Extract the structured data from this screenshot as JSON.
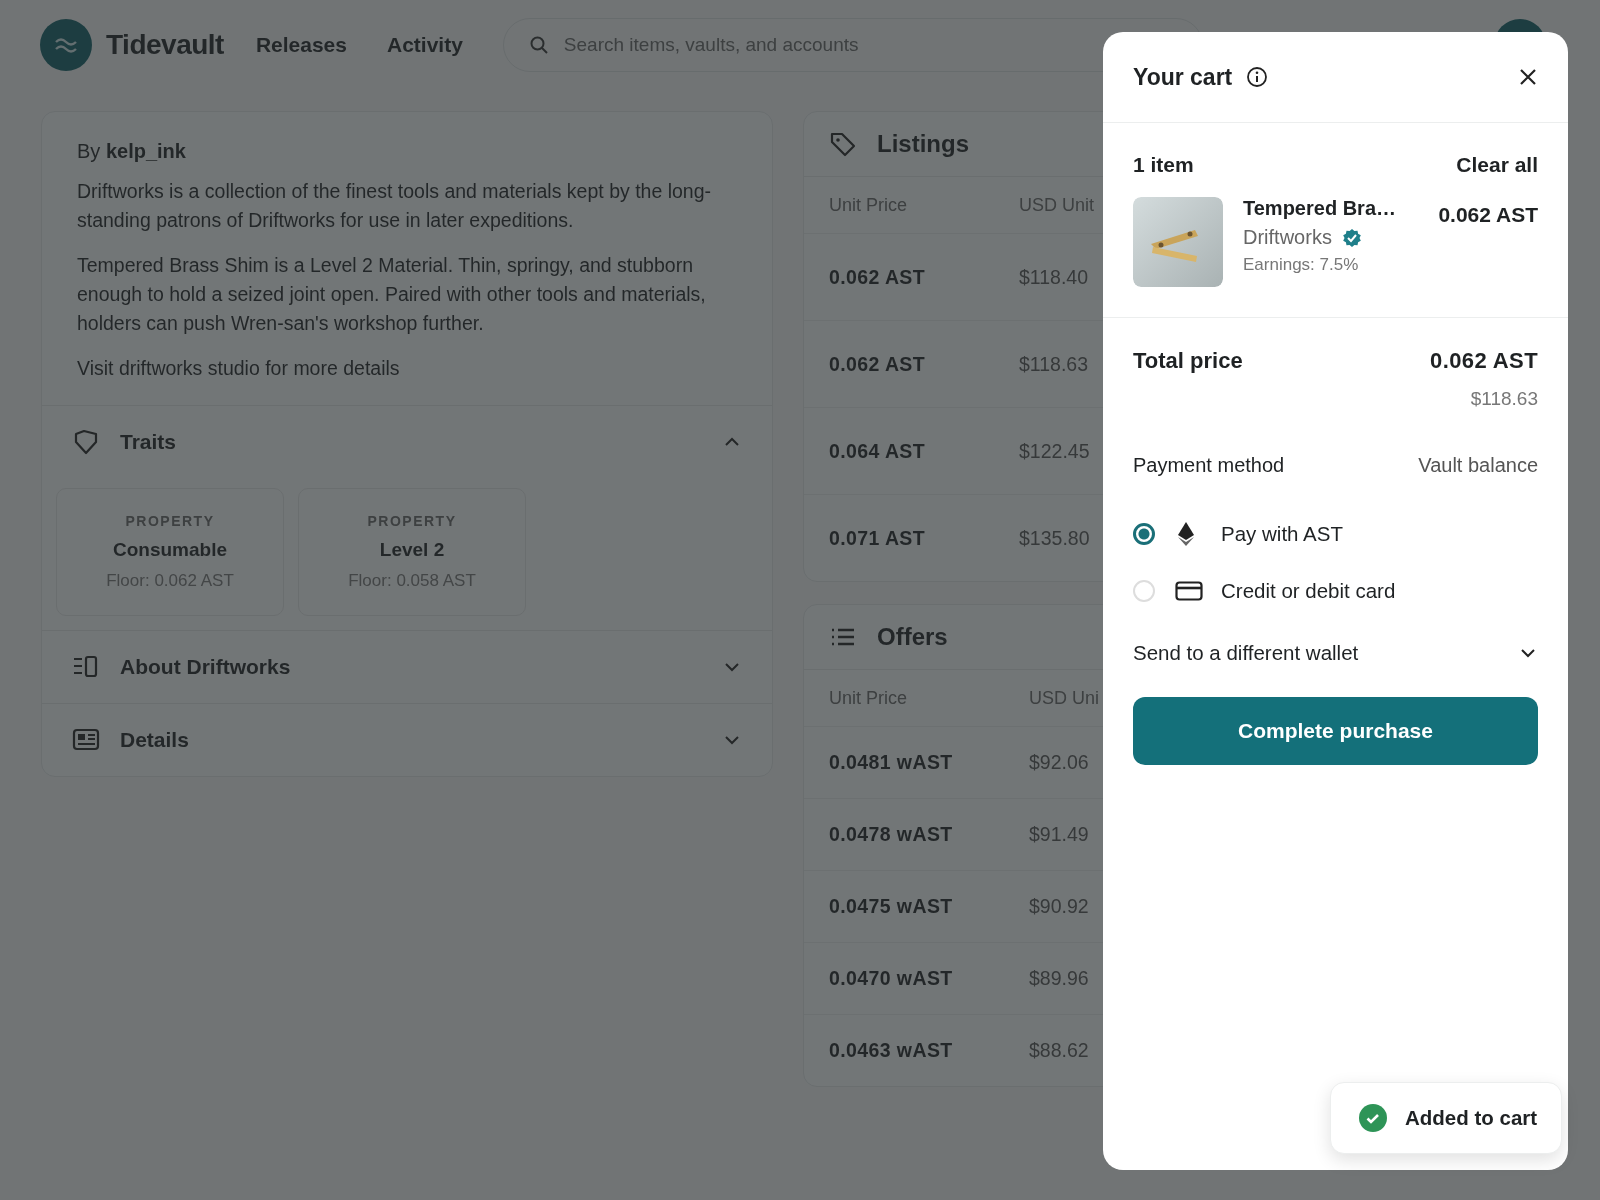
{
  "header": {
    "logo": "Tidevault",
    "nav": [
      {
        "label": "Releases"
      },
      {
        "label": "Activity"
      }
    ],
    "search": {
      "placeholder": "Search items, vaults, and accounts"
    }
  },
  "description": {
    "by_label": "By",
    "creator": "kelp_ink",
    "paragraphs": [
      "Driftworks is a collection of the finest tools and materials kept by the long-standing patrons of Driftworks for use in later expeditions.",
      "Tempered Brass Shim is a Level 2 Material. Thin, springy, and stubborn enough to hold a seized joint open. Paired with other tools and materials, holders can push Wren-san's workshop further.",
      "Visit driftworks studio for more details"
    ]
  },
  "sections": [
    {
      "kind": "traits",
      "title": "Traits",
      "expanded": true,
      "traits": [
        {
          "type": "PROPERTY",
          "value": "Consumable",
          "floor": "Floor: 0.062 AST"
        },
        {
          "type": "PROPERTY",
          "value": "Level 2",
          "floor": "Floor: 0.058 AST"
        }
      ]
    },
    {
      "kind": "about",
      "title": "About Driftworks",
      "expanded": false
    },
    {
      "kind": "details",
      "title": "Details",
      "expanded": false
    }
  ],
  "listings": {
    "title": "Listings",
    "columns": [
      "Unit Price",
      "USD Unit"
    ],
    "rows": [
      [
        "0.062 AST",
        "$118.40"
      ],
      [
        "0.062 AST",
        "$118.63"
      ],
      [
        "0.064 AST",
        "$122.45"
      ],
      [
        "0.071 AST",
        "$135.80"
      ]
    ]
  },
  "offers": {
    "title": "Offers",
    "columns": [
      "Unit Price",
      "USD Uni"
    ],
    "rows": [
      [
        "0.0481 wAST",
        "$92.06"
      ],
      [
        "0.0478 wAST",
        "$91.49"
      ],
      [
        "0.0475 wAST",
        "$90.92"
      ],
      [
        "0.0470 wAST",
        "$89.96"
      ],
      [
        "0.0463 wAST",
        "$88.62"
      ]
    ]
  },
  "cart": {
    "title": "Your cart",
    "count": "1 item",
    "clear": "Clear all",
    "item": {
      "name": "Tempered Bra…",
      "collection": "Driftworks",
      "verified": true,
      "earnings": "Earnings: 7.5%",
      "price": "0.062 AST"
    },
    "total": {
      "label": "Total price",
      "value": "0.062 AST",
      "usd": "$118.63"
    },
    "payment": {
      "label": "Payment method",
      "source": "Vault balance",
      "options": [
        {
          "kind": "crypto",
          "label": "Pay with AST",
          "selected": true
        },
        {
          "kind": "card",
          "label": "Credit or debit card",
          "selected": false
        }
      ]
    },
    "send_wallet": {
      "label": "Send to a different wallet",
      "expanded": false
    },
    "button": "Complete purchase",
    "toast": "Added to cart"
  }
}
